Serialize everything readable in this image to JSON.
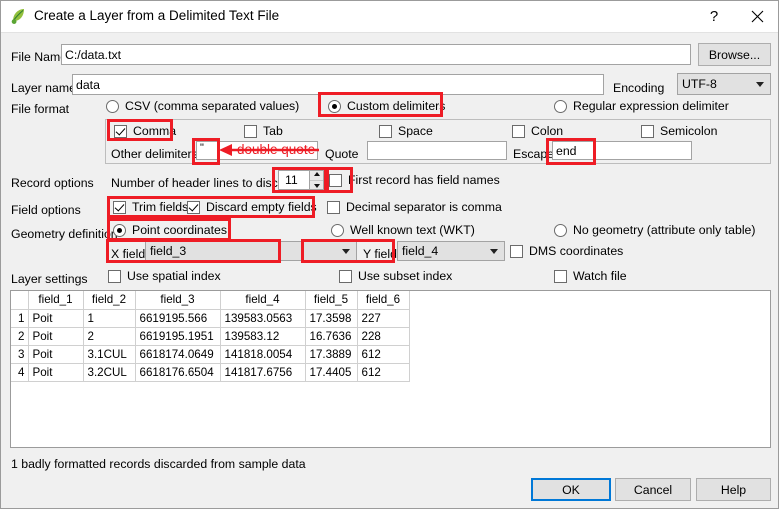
{
  "window": {
    "title": "Create a Layer from a Delimited Text File",
    "icon": "qgis-logo-icon",
    "help_button": "?",
    "close_button": "✕"
  },
  "form": {
    "file_name_label": "File Name",
    "file_name_value": "C:/data.txt",
    "browse_button": "Browse...",
    "layer_name_label": "Layer name",
    "layer_name_value": "data",
    "encoding_label": "Encoding",
    "encoding_value": "UTF-8",
    "file_format_label": "File format",
    "format_options": [
      {
        "label": "CSV (comma separated values)",
        "selected": false
      },
      {
        "label": "Custom delimiters",
        "selected": true
      },
      {
        "label": "Regular expression delimiter",
        "selected": false
      }
    ],
    "delimiters": {
      "comma": {
        "label": "Comma",
        "checked": true
      },
      "tab": {
        "label": "Tab",
        "checked": false
      },
      "space": {
        "label": "Space",
        "checked": false
      },
      "colon": {
        "label": "Colon",
        "checked": false
      },
      "semicolon": {
        "label": "Semicolon",
        "checked": false
      },
      "other_label": "Other delimiters",
      "other_value": "\"",
      "quote_label": "Quote",
      "quote_value": "",
      "escape_label": "Escape",
      "escape_value": "end"
    },
    "record_options_label": "Record options",
    "header_lines_label": "Number of header lines to discard",
    "header_lines_value": "11",
    "first_record_label": "First record has field names",
    "first_record_checked": false,
    "field_options_label": "Field options",
    "trim_fields": {
      "label": "Trim fields",
      "checked": true
    },
    "discard_empty": {
      "label": "Discard empty fields",
      "checked": true
    },
    "decimal_comma": {
      "label": "Decimal separator is comma",
      "checked": false
    },
    "geometry_label": "Geometry definition",
    "geometry_options": [
      {
        "label": "Point coordinates",
        "selected": true
      },
      {
        "label": "Well known text (WKT)",
        "selected": false
      },
      {
        "label": "No geometry (attribute only table)",
        "selected": false
      }
    ],
    "x_field_label": "X field",
    "x_field_value": "field_3",
    "y_field_label": "Y field",
    "y_field_value": "field_4",
    "dms_label": "DMS coordinates",
    "dms_checked": false,
    "layer_settings_label": "Layer settings",
    "spatial_index": {
      "label": "Use spatial index",
      "checked": false
    },
    "subset_index": {
      "label": "Use subset index",
      "checked": false
    },
    "watch_file": {
      "label": "Watch file",
      "checked": false
    }
  },
  "preview": {
    "columns": [
      "field_1",
      "field_2",
      "field_3",
      "field_4",
      "field_5",
      "field_6"
    ],
    "rows": [
      {
        "num": "1",
        "cells": [
          "Poit",
          "1",
          "6619195.566",
          "139583.0563",
          "17.3598",
          "227"
        ]
      },
      {
        "num": "2",
        "cells": [
          "Poit",
          "2",
          "6619195.1951",
          "139583.12",
          "16.7636",
          "228"
        ]
      },
      {
        "num": "3",
        "cells": [
          "Poit",
          "3.1CUL",
          "6618174.0649",
          "141818.0054",
          "17.3889",
          "612"
        ]
      },
      {
        "num": "4",
        "cells": [
          "Poit",
          "3.2CUL",
          "6618176.6504",
          "141817.6756",
          "17.4405",
          "612"
        ]
      }
    ]
  },
  "status_message": "1 badly formatted records discarded from sample data",
  "buttons": {
    "ok": "OK",
    "cancel": "Cancel",
    "help": "Help"
  },
  "annotations": {
    "double_quote_note": "double quote",
    "highlight_color": "#ee1c25"
  }
}
